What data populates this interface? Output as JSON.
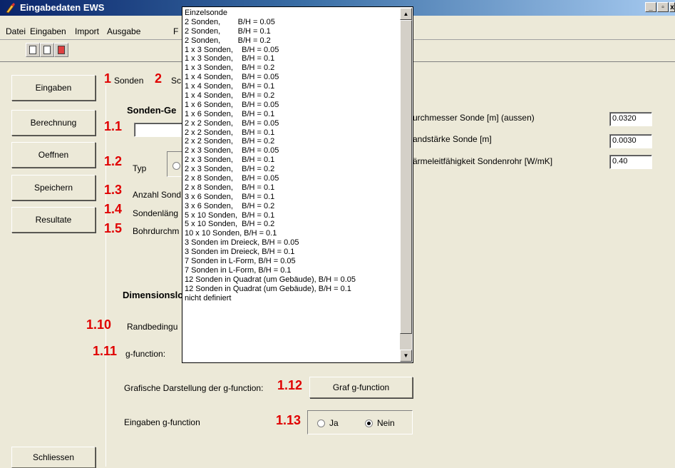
{
  "window": {
    "title": "Eingabedaten EWS",
    "min_label": "_",
    "max_label": "▫",
    "close_label": "x"
  },
  "menu": [
    "Datei",
    "Eingaben",
    "Import",
    "Ausgabe",
    "F"
  ],
  "sidebar": {
    "buttons": [
      "Eingaben",
      "Berechnung",
      "Oeffnen",
      "Speichern",
      "Resultate"
    ],
    "close_button": "Schliessen"
  },
  "tabs": {
    "sonden_marker": "1",
    "sonden_label": "Sonden",
    "second_marker": "2",
    "second_label": "Sc"
  },
  "form": {
    "section_title": "Sonden-Ge",
    "markers": {
      "m1_1": "1.1",
      "m1_2": "1.2",
      "m1_3": "1.3",
      "m1_4": "1.4",
      "m1_5": "1.5",
      "m1_10": "1.10",
      "m1_11": "1.11",
      "m1_12": "1.12",
      "m1_13": "1.13"
    },
    "typ_label": "Typ",
    "anzahl_label": "Anzahl Sond",
    "laenge_label": "Sondenläng",
    "bohr_label": "Bohrdurchm",
    "dimension_label": "Dimensionslo",
    "rand_label": "Randbedingu",
    "gfunc_label": "g-function:",
    "graf_label": "Grafische Darstellung der g-function:",
    "graf_button": "Graf g-function",
    "eingaben_gfunc_label": "Eingaben g-function",
    "radio_ja": "Ja",
    "radio_nein": "Nein",
    "radio_selected": "Nein"
  },
  "right_fields": [
    {
      "label": "urchmesser Sonde [m] (aussen)",
      "value": "0.0320"
    },
    {
      "label": "andstärke Sonde [m]",
      "value": "0.0030"
    },
    {
      "label": "ärmeleitfähigkeit Sondenrohr [W/mK]",
      "value": "0.40"
    }
  ],
  "dropdown": {
    "items": [
      "Einzelsonde",
      "2 Sonden,        B/H = 0.05",
      "2 Sonden,        B/H = 0.1",
      "2 Sonden,        B/H = 0.2",
      "1 x 3 Sonden,    B/H = 0.05",
      "1 x 3 Sonden,    B/H = 0.1",
      "1 x 3 Sonden,    B/H = 0.2",
      "1 x 4 Sonden,    B/H = 0.05",
      "1 x 4 Sonden,    B/H = 0.1",
      "1 x 4 Sonden,    B/H = 0.2",
      "1 x 6 Sonden,    B/H = 0.05",
      "1 x 6 Sonden,    B/H = 0.1",
      "2 x 2 Sonden,    B/H = 0.05",
      "2 x 2 Sonden,    B/H = 0.1",
      "2 x 2 Sonden,    B/H = 0.2",
      "2 x 3 Sonden,    B/H = 0.05",
      "2 x 3 Sonden,    B/H = 0.1",
      "2 x 3 Sonden,    B/H = 0.2",
      "2 x 8 Sonden,    B/H = 0.05",
      "2 x 8 Sonden,    B/H = 0.1",
      "3 x 6 Sonden,    B/H = 0.1",
      "3 x 6 Sonden,    B/H = 0.2",
      "5 x 10 Sonden,  B/H = 0.1",
      "5 x 10 Sonden,  B/H = 0.2",
      "10 x 10 Sonden, B/H = 0.1",
      "3 Sonden im Dreieck, B/H = 0.05",
      "3 Sonden im Dreieck, B/H = 0.1",
      "7 Sonden in L-Form, B/H = 0.05",
      "7 Sonden in L-Form, B/H = 0.1",
      "12 Sonden in Quadrat (um Gebäude), B/H = 0.05",
      "12 Sonden in Quadrat (um Gebäude), B/H = 0.1",
      "nicht definiert"
    ],
    "icons": {
      "up": "triangle-up-icon",
      "down": "triangle-down-icon"
    }
  }
}
